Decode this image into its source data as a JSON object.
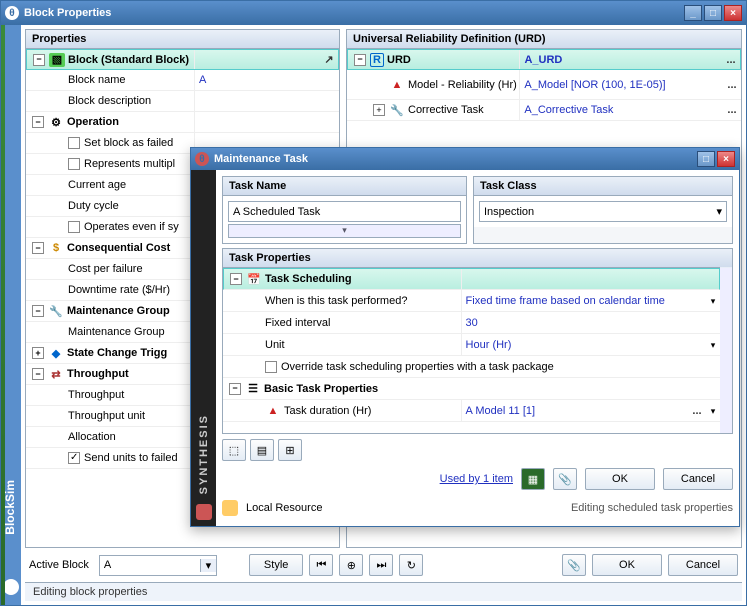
{
  "window": {
    "title": "Block Properties",
    "minimize": "_",
    "maximize": "□",
    "close": "×"
  },
  "sidebar_brand": "BlockSim",
  "panels": {
    "left": {
      "title": "Properties",
      "block_header": "Block (Standard Block)",
      "rows": {
        "block_name_label": "Block name",
        "block_name_value": "A",
        "block_desc_label": "Block description",
        "operation": "Operation",
        "set_failed": "Set block as failed",
        "represents": "Represents multipl",
        "current_age": "Current age",
        "duty_cycle": "Duty cycle",
        "operates_even": "Operates even if sy",
        "conseq": "Consequential Cost",
        "cost_per_failure": "Cost per failure",
        "downtime_rate": "Downtime rate ($/Hr)",
        "maint_group": "Maintenance Group",
        "maint_group_item": "Maintenance Group",
        "state_change": "State Change Trigg",
        "throughput": "Throughput",
        "throughput_item": "Throughput",
        "throughput_unit": "Throughput unit",
        "allocation": "Allocation",
        "send_units": "Send units to failed"
      }
    },
    "right": {
      "title": "Universal Reliability Definition (URD)",
      "urd_header": "URD",
      "urd_value": "A_URD",
      "model_label": "Model - Reliability (Hr)",
      "model_value": "A_Model [NOR (100, 1E-05)]",
      "corrective_label": "Corrective Task",
      "corrective_value": "A_Corrective Task"
    }
  },
  "float": {
    "title": "Maintenance Task",
    "brand": "SYNTHESIS",
    "task_name_header": "Task Name",
    "task_name_value": "A Scheduled Task",
    "task_class_header": "Task Class",
    "task_class_value": "Inspection",
    "task_properties_header": "Task Properties",
    "scheduling_header": "Task Scheduling",
    "when_label": "When is this task performed?",
    "when_value": "Fixed time frame based on calendar time",
    "fixed_interval_label": "Fixed interval",
    "fixed_interval_value": "30",
    "unit_label": "Unit",
    "unit_value": "Hour (Hr)",
    "override_label": "Override task scheduling properties with a task package",
    "basic_header": "Basic Task Properties",
    "duration_label": "Task duration (Hr)",
    "duration_value": "A Model 11 [1]",
    "used_by": "Used by 1 item",
    "ok": "OK",
    "cancel": "Cancel",
    "local_resource": "Local Resource",
    "editing": "Editing scheduled task properties"
  },
  "bottom": {
    "active_block_label": "Active Block",
    "active_block_value": "A",
    "style": "Style",
    "ok": "OK",
    "cancel": "Cancel"
  },
  "status": "Editing block properties",
  "more": "..."
}
